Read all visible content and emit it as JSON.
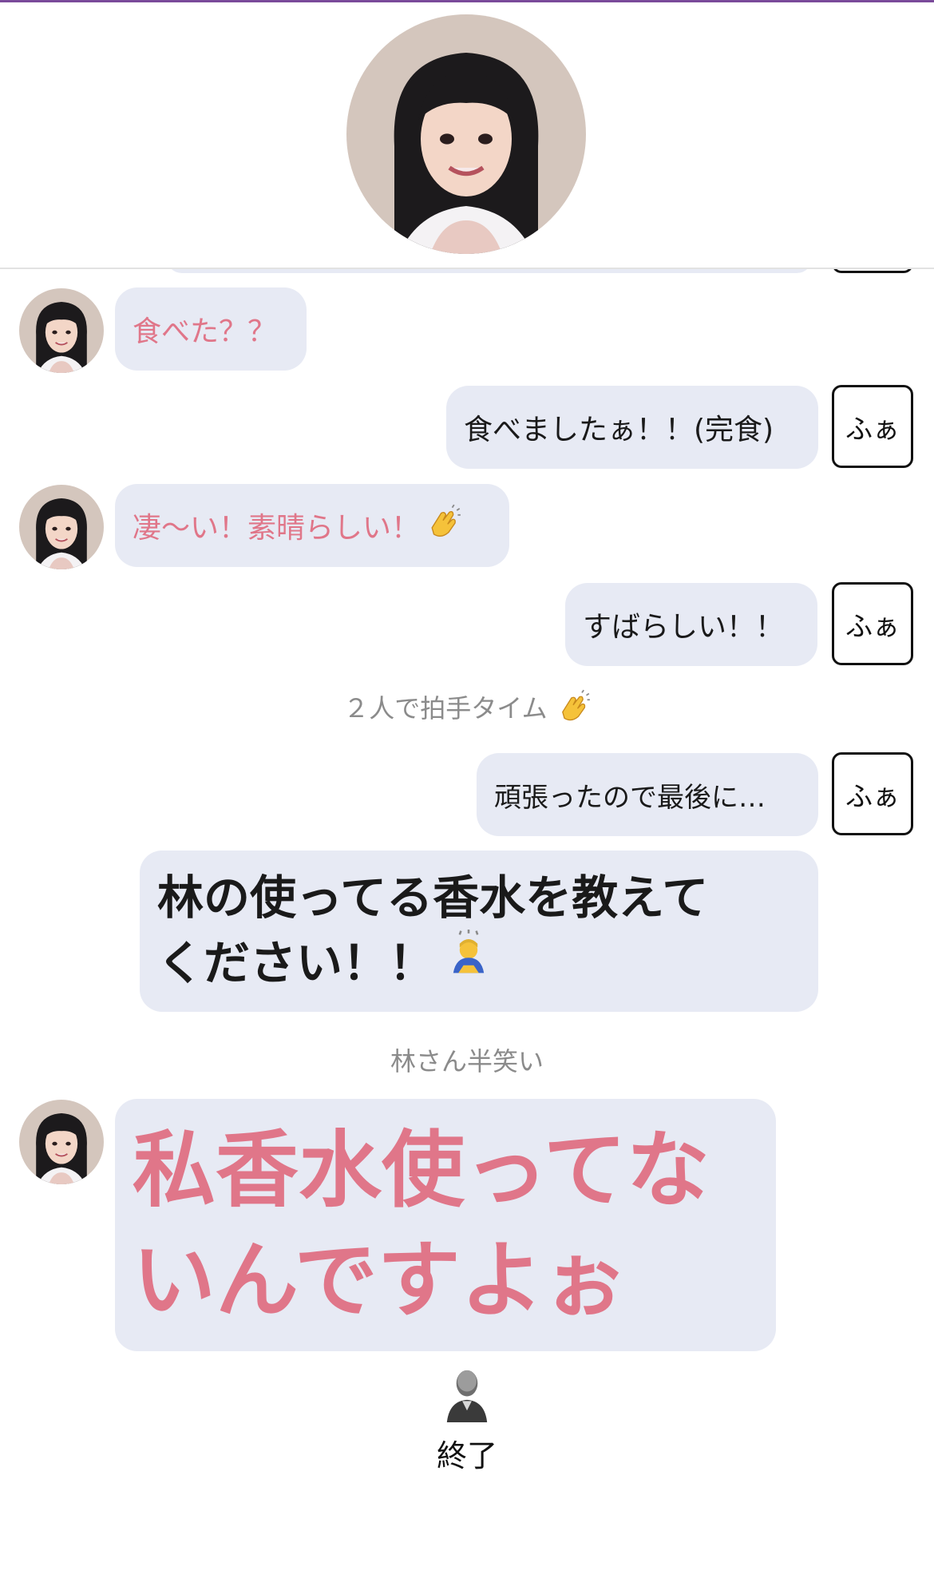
{
  "chat": {
    "msg1": "食べた？？",
    "reply1": "食べましたぁ！！(完食)",
    "msg2": "凄〜い！素晴らしい！",
    "reply2": "すばらしい！！",
    "note1": "２人で拍手タイム",
    "reply3": "頑張ったので最後に…",
    "reply4_line1": "林の使ってる香水を教えて",
    "reply4_line2": "ください！！",
    "note2": "林さん半笑い",
    "msg3_line1": "私香水使ってな",
    "msg3_line2": "いんですよぉ",
    "user_badge": "ふぁ",
    "end_label": "終了"
  },
  "colors": {
    "bubble_bg": "#e7eaf4",
    "talent_text": "#e07689",
    "fan_text": "#1a1a1a",
    "note_text": "#8b8b8b",
    "accent_line": "#7a4a9a"
  },
  "icons": [
    "portrait-avatar",
    "clapping-hands-icon",
    "bowing-person-icon",
    "person-silhouette-icon"
  ]
}
